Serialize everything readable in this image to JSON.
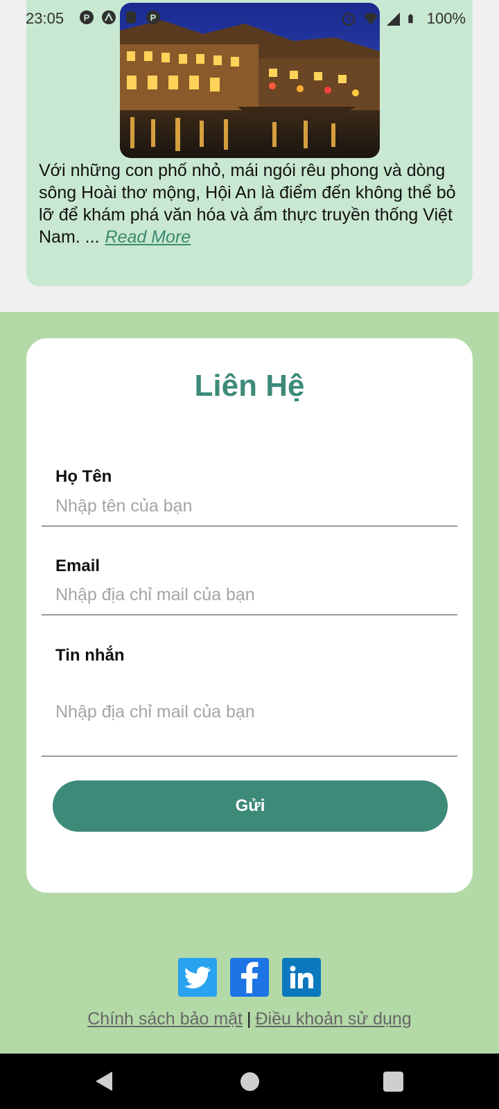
{
  "status_bar": {
    "time": "23:05",
    "battery": "100%",
    "left_icons": [
      "pinterest-icon",
      "apex-icon",
      "database-icon",
      "pinterest-icon"
    ],
    "right_icons": [
      "alarm-icon",
      "wifi-icon",
      "signal-icon",
      "battery-icon"
    ]
  },
  "article": {
    "text": "Với những con phố nhỏ, mái ngói rêu phong và dòng sông Hoài thơ mộng, Hội An là điểm đến không thể bỏ lỡ để khám phá văn hóa và ẩm thực truyền thống Việt Nam. ...",
    "read_more": "Read More"
  },
  "contact": {
    "title": "Liên Hệ",
    "name_label": "Họ Tên",
    "name_placeholder": "Nhập tên của bạn",
    "email_label": "Email",
    "email_placeholder": "Nhập địa chỉ mail của bạn",
    "message_label": "Tin nhắn",
    "message_placeholder": "Nhập địa chỉ mail của bạn",
    "send_label": "Gửi"
  },
  "social": [
    "twitter-icon",
    "facebook-icon",
    "linkedin-icon"
  ],
  "footer": {
    "privacy": "Chính sách bảo mật",
    "separator": "|",
    "terms": "Điều khoản sử dụng"
  },
  "colors": {
    "accent": "#3d8a78",
    "card_bg": "#c9e8d1",
    "section_bg": "#b3d9a7"
  }
}
